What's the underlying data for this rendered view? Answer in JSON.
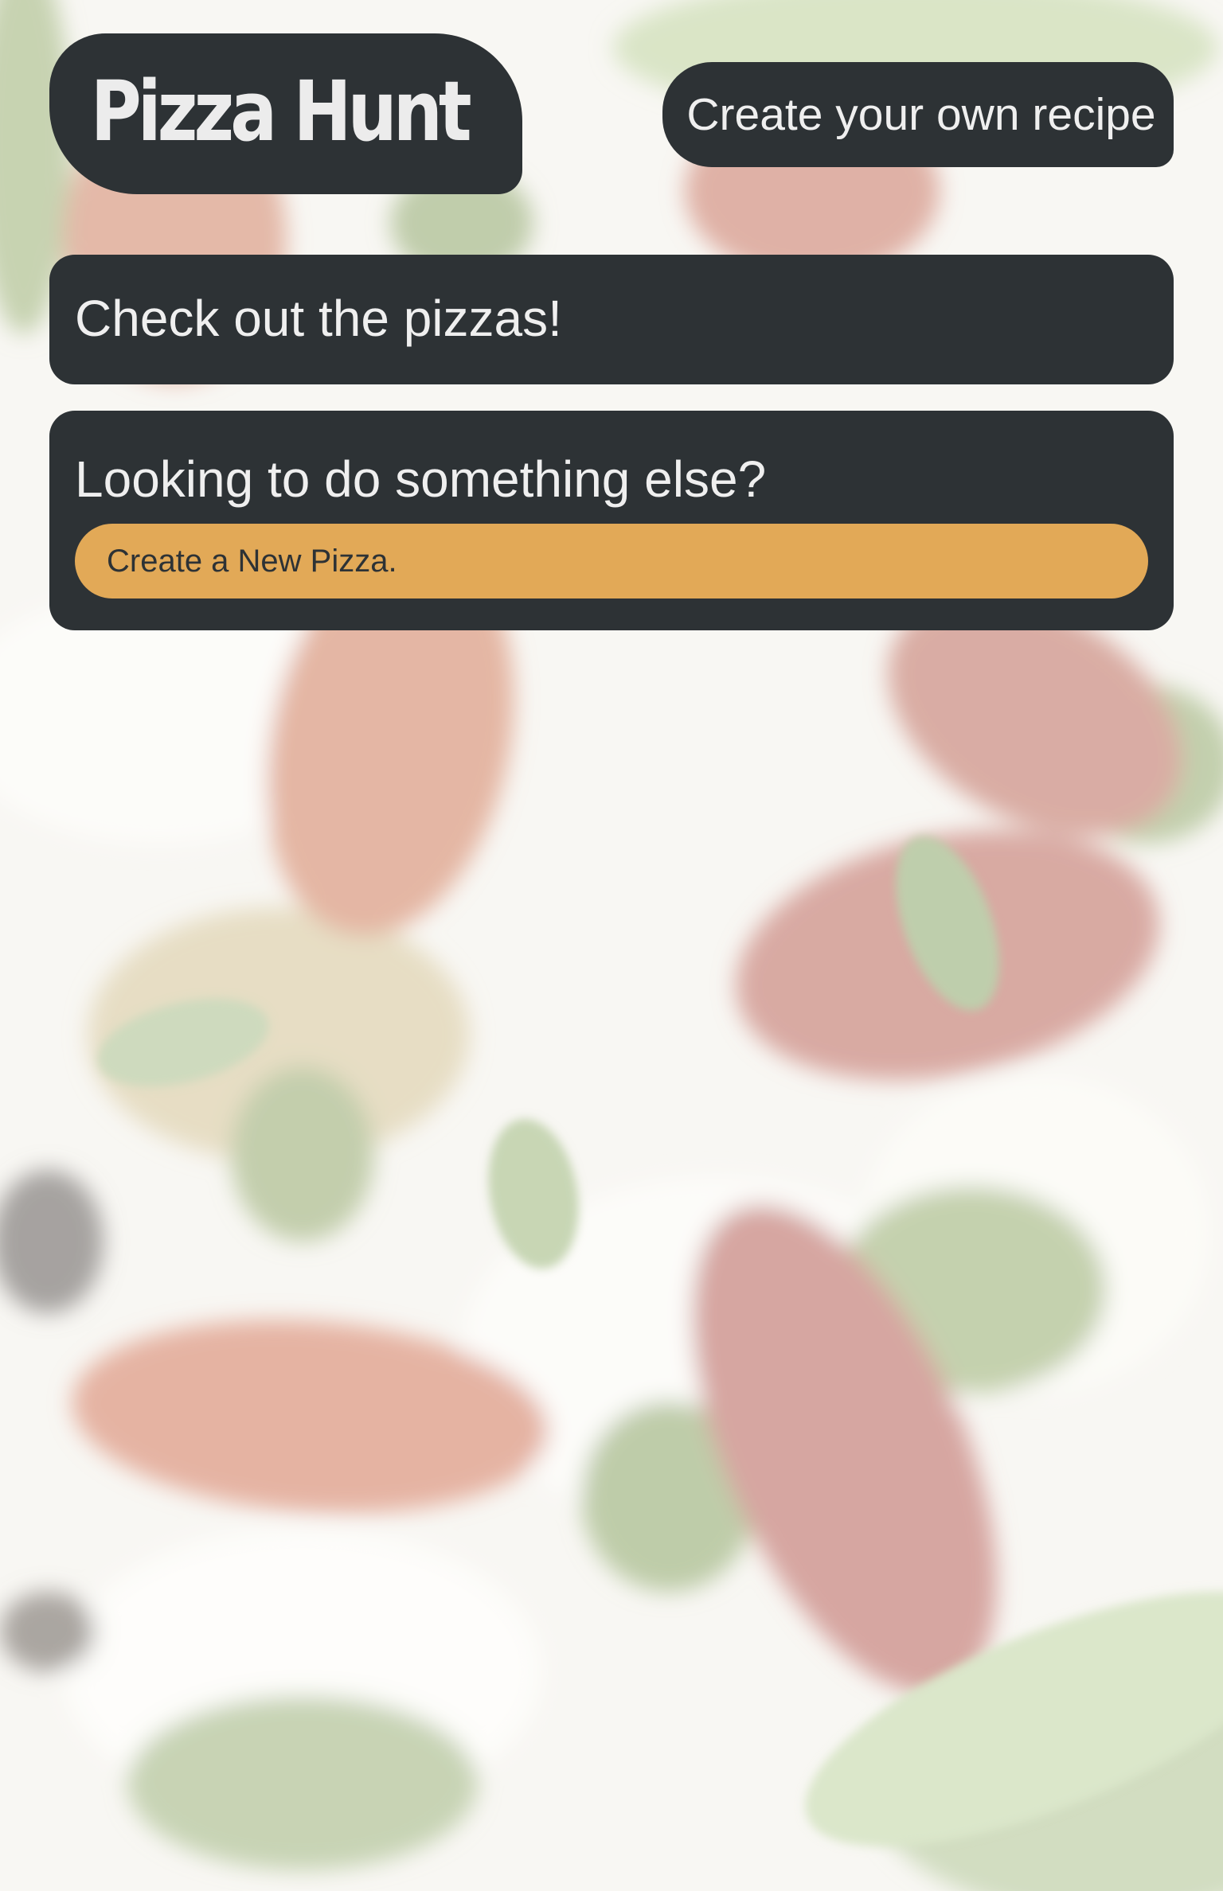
{
  "header": {
    "logo_text": "Pizza Hunt",
    "create_recipe_label": "Create your own recipe"
  },
  "main": {
    "check_pizzas_label": "Check out the pizzas!",
    "something_else": {
      "heading": "Looking to do something else?",
      "create_pizza_label": "Create a New Pizza."
    }
  },
  "colors": {
    "panel_dark": "#2d3235",
    "accent_button": "#e2a957",
    "panel_text": "#efefef"
  }
}
